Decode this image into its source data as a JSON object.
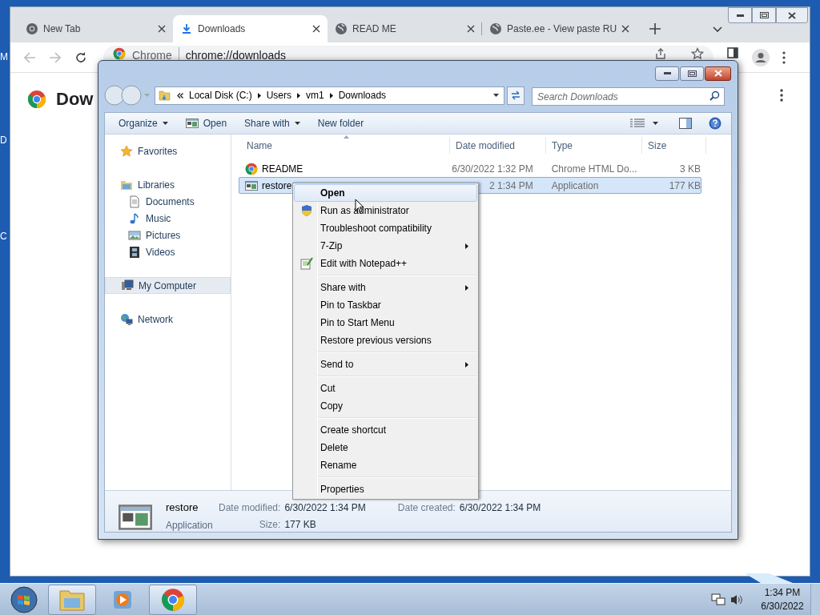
{
  "desktop": {
    "labels": [
      "M",
      "D",
      "C"
    ]
  },
  "browser": {
    "tabs": [
      {
        "title": "New Tab",
        "kind": "chrome",
        "selected": false
      },
      {
        "title": "Downloads",
        "kind": "download",
        "selected": true
      },
      {
        "title": "READ ME",
        "kind": "globe",
        "selected": false
      },
      {
        "title": "Paste.ee - View paste RU",
        "kind": "globe",
        "selected": false
      }
    ],
    "address": {
      "site_chip": "Chrome",
      "url": "chrome://downloads"
    },
    "page": {
      "heading": "Dow"
    }
  },
  "explorer": {
    "breadcrumb": [
      "Local Disk (C:)",
      "Users",
      "vm1",
      "Downloads"
    ],
    "search": {
      "placeholder": "Search Downloads"
    },
    "toolbar": [
      {
        "label": "Organize",
        "dropdown": true,
        "kind": "text"
      },
      {
        "label": "Open",
        "dropdown": false,
        "kind": "app"
      },
      {
        "label": "Share with",
        "dropdown": true,
        "kind": "text"
      },
      {
        "label": "New folder",
        "dropdown": false,
        "kind": "text"
      }
    ],
    "nav": [
      {
        "label": "Favorites",
        "kind": "star",
        "selected": false
      },
      {
        "label": "Libraries",
        "kind": "library",
        "selected": false,
        "children": [
          {
            "label": "Documents",
            "kind": "document",
            "selected": false
          },
          {
            "label": "Music",
            "kind": "music",
            "selected": false
          },
          {
            "label": "Pictures",
            "kind": "pictures",
            "selected": false
          },
          {
            "label": "Videos",
            "kind": "videos",
            "selected": false
          }
        ]
      },
      {
        "label": "My Computer",
        "kind": "computer",
        "selected": true
      },
      {
        "label": "Network",
        "kind": "network",
        "selected": false
      }
    ],
    "columns": [
      "Name",
      "Date modified",
      "Type",
      "Size"
    ],
    "files": [
      {
        "name": "README",
        "kind": "chrome",
        "date": "6/30/2022 1:32 PM",
        "type": "Chrome HTML Do...",
        "size": "3 KB",
        "selected": false
      },
      {
        "name": "restore",
        "kind": "app",
        "date": "2 1:34 PM",
        "type": "Application",
        "size": "177 KB",
        "selected": true
      }
    ],
    "details": {
      "name": "restore",
      "kind": "Application",
      "fields": [
        {
          "label": "Date modified:",
          "value": "6/30/2022 1:34 PM"
        },
        {
          "label": "Size:",
          "value": "177 KB"
        },
        {
          "label": "Date created:",
          "value": "6/30/2022 1:34 PM"
        }
      ]
    }
  },
  "context_menu": {
    "groups": [
      {
        "items": [
          {
            "label": "Open",
            "default": true,
            "submenu": false,
            "selected": true,
            "kind": "plain"
          },
          {
            "label": "Run as administrator",
            "default": false,
            "submenu": false,
            "selected": false,
            "kind": "shield"
          },
          {
            "label": "Troubleshoot compatibility",
            "default": false,
            "submenu": false,
            "selected": false,
            "kind": "plain"
          },
          {
            "label": "7-Zip",
            "default": false,
            "submenu": true,
            "selected": false,
            "kind": "plain"
          },
          {
            "label": "Edit with Notepad++",
            "default": false,
            "submenu": false,
            "selected": false,
            "kind": "notepad"
          }
        ]
      },
      {
        "items": [
          {
            "label": "Share with",
            "default": false,
            "submenu": true,
            "selected": false,
            "kind": "plain"
          },
          {
            "label": "Pin to Taskbar",
            "default": false,
            "submenu": false,
            "selected": false,
            "kind": "plain"
          },
          {
            "label": "Pin to Start Menu",
            "default": false,
            "submenu": false,
            "selected": false,
            "kind": "plain"
          },
          {
            "label": "Restore previous versions",
            "default": false,
            "submenu": false,
            "selected": false,
            "kind": "plain"
          }
        ]
      },
      {
        "items": [
          {
            "label": "Send to",
            "default": false,
            "submenu": true,
            "selected": false,
            "kind": "plain"
          }
        ]
      },
      {
        "items": [
          {
            "label": "Cut",
            "default": false,
            "submenu": false,
            "selected": false,
            "kind": "plain"
          },
          {
            "label": "Copy",
            "default": false,
            "submenu": false,
            "selected": false,
            "kind": "plain"
          }
        ]
      },
      {
        "items": [
          {
            "label": "Create shortcut",
            "default": false,
            "submenu": false,
            "selected": false,
            "kind": "plain"
          },
          {
            "label": "Delete",
            "default": false,
            "submenu": false,
            "selected": false,
            "kind": "plain"
          },
          {
            "label": "Rename",
            "default": false,
            "submenu": false,
            "selected": false,
            "kind": "plain"
          }
        ]
      },
      {
        "items": [
          {
            "label": "Properties",
            "default": false,
            "submenu": false,
            "selected": false,
            "kind": "plain"
          }
        ]
      }
    ]
  },
  "taskbar": {
    "apps": [
      {
        "kind": "folder",
        "running": true
      },
      {
        "kind": "media",
        "running": false
      },
      {
        "kind": "chrome",
        "running": true
      }
    ],
    "clock": {
      "time": "1:34 PM",
      "date": "6/30/2022"
    }
  }
}
